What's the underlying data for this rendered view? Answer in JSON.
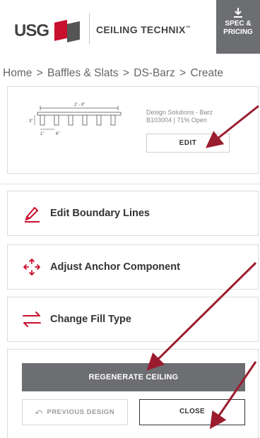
{
  "header": {
    "logo_text": "USG",
    "brand_name": "CEILING TECHNIX",
    "brand_tm": "™",
    "spec_button": {
      "line1": "SPEC &",
      "line2": "PRICING",
      "icon": "download-icon"
    }
  },
  "breadcrumb": {
    "items": [
      "Home",
      "Baffles & Slats",
      "DS-Barz",
      "Create"
    ],
    "separator": ">"
  },
  "product": {
    "name": "Design Solutions - Barz",
    "code_line": "B103004 | 71% Open",
    "diagram_labels": {
      "top": "2' - 0\"",
      "left": "3\"",
      "gap1": "1\"",
      "gap2": "6\""
    },
    "edit_label": "EDIT"
  },
  "tools": [
    {
      "label": "Edit Boundary Lines",
      "icon": "pencil-icon"
    },
    {
      "label": "Adjust Anchor Component",
      "icon": "move-arrows-icon"
    },
    {
      "label": "Change Fill Type",
      "icon": "swap-arrows-icon"
    }
  ],
  "actions": {
    "regenerate_label": "REGENERATE CEILING",
    "previous_label": "PREVIOUS DESIGN",
    "close_label": "CLOSE"
  },
  "colors": {
    "accent_red": "#c8102e",
    "annotation_arrow": "#9b1c2e",
    "button_gray": "#6d6e71"
  }
}
